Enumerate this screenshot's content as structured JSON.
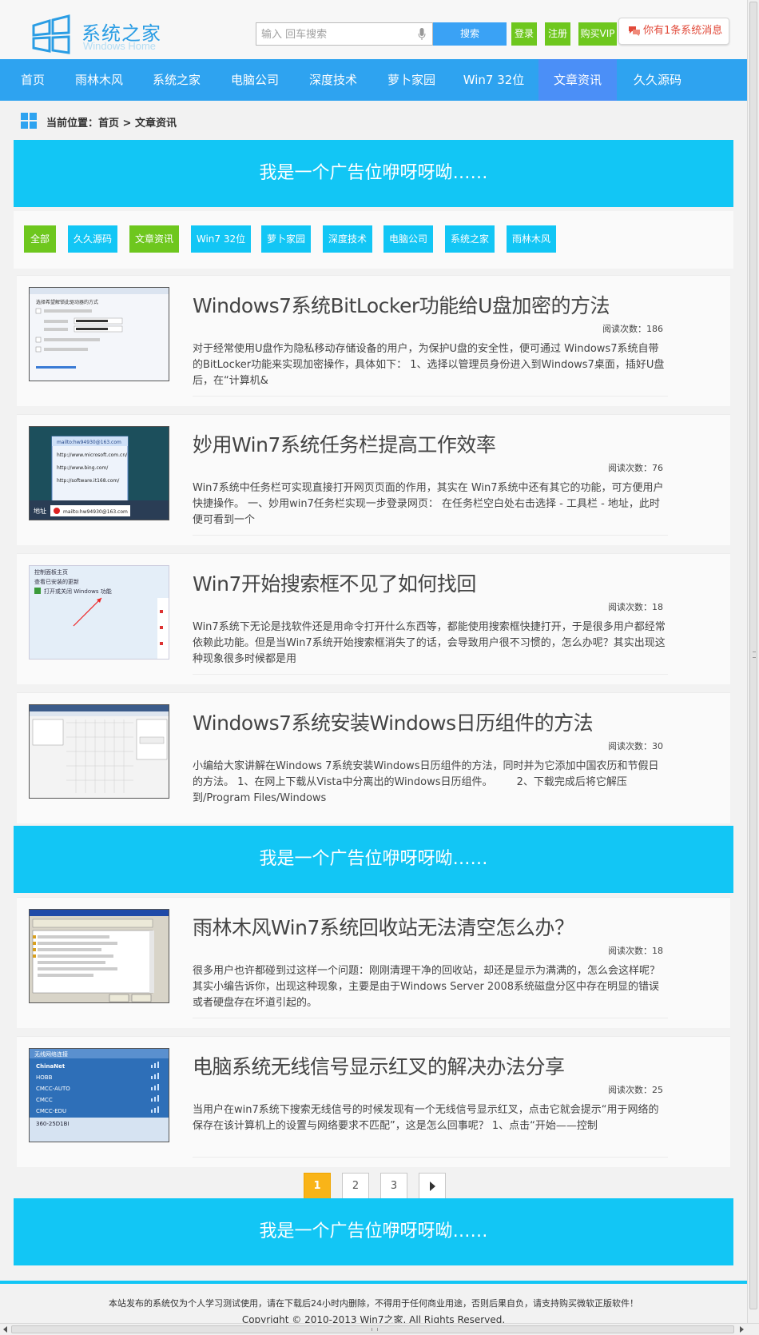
{
  "header": {
    "logo_text": "系统之家",
    "logo_sub": "Windows Home",
    "search_placeholder": "输入 回车搜索",
    "search_button": "搜索",
    "login": "登录",
    "register": "注册",
    "vip": "购买VIP",
    "message": "你有1条系统消息"
  },
  "nav": [
    "首页",
    "雨林木风",
    "系统之家",
    "电脑公司",
    "深度技术",
    "萝卜家园",
    "Win7 32位",
    "文章资讯",
    "久久源码"
  ],
  "breadcrumb": "当前位置：首页 > 文章资讯",
  "ads": [
    "我是一个广告位咿呀呀呦……",
    "我是一个广告位咿呀呀呦……",
    "我是一个广告位咿呀呀呦……"
  ],
  "filters": [
    "全部",
    "久久源码",
    "文章资讯",
    "Win7 32位",
    "萝卜家园",
    "深度技术",
    "电脑公司",
    "系统之家",
    "雨林木风"
  ],
  "articles": [
    {
      "title": "Windows7系统BitLocker功能给U盘加密的方法",
      "reads": "阅读次数：186",
      "desc": "对于经常使用U盘作为隐私移动存储设备的用户，为保护U盘的安全性，便可通过 Windows7系统自带的BitLocker功能来实现加密操作，具体如下： 1、选择以管理员身份进入到Windows7桌面，插好U盘后，在“计算机&"
    },
    {
      "title": "妙用Win7系统任务栏提高工作效率",
      "reads": "阅读次数：76",
      "desc": "Win7系统中任务栏可实现直接打开网页页面的作用，其实在 Win7系统中还有其它的功能，可方便用户快捷操作。 一、妙用win7任务栏实现一步登录网页： 在任务栏空白处右击选择 - 工具栏 - 地址，此时便可看到一个"
    },
    {
      "title": "Win7开始搜索框不见了如何找回",
      "reads": "阅读次数：18",
      "desc": "Win7系统下无论是找软件还是用命令打开什么东西等，都能使用搜索框快捷打开，于是很多用户都经常依赖此功能。但是当Win7系统开始搜索框消失了的话，会导致用户很不习惯的，怎么办呢？其实出现这种现象很多时候都是用"
    },
    {
      "title": "Windows7系统安装Windows日历组件的方法",
      "reads": "阅读次数：30",
      "desc": "小编给大家讲解在Windows 7系统安装Windows日历组件的方法，同时并为它添加中国农历和节假日的方法。 1、在网上下载从Vista中分离出的Windows日历组件。 　　2、下载完成后将它解压到/Program Files/Windows"
    },
    {
      "title": "雨林木风Win7系统回收站无法清空怎么办？",
      "reads": "阅读次数：18",
      "desc": "很多用户也许都碰到过这样一个问题：刚刚清理干净的回收站，却还是显示为满满的，怎么会这样呢？其实小编告诉你，出现这种现象，主要是由于Windows Server 2008系统磁盘分区中存在明显的错误或者硬盘存在坏道引起的。"
    },
    {
      "title": "电脑系统无线信号显示红叉的解决办法分享",
      "reads": "阅读次数：25",
      "desc": "当用户在win7系统下搜索无线信号的时候发现有一个无线信号显示红叉，点击它就会提示“用于网络的保存在该计算机上的设置与网络要求不匹配”，这是怎么回事呢？ 1、点击“开始——控制"
    }
  ],
  "thumb_text": {
    "t1_caption": "选择希望解锁此驱动器的方式",
    "t2_items": [
      "mailto:hw94930@163.com",
      "http://www.microsoft.com.cn/",
      "http://www.bing.com/",
      "http://software.it168.com/"
    ],
    "t2_label": "地址",
    "t3_lines": [
      "控制面板主页",
      "查看已安装的更新",
      "打开或关闭 Windows 功能"
    ],
    "t6_title": "无线网络连接",
    "t6_items": [
      "ChinaNet",
      "HOBB",
      "CMCC-AUTO",
      "CMCC",
      "CMCC-EDU",
      "360-25D1BI"
    ]
  },
  "pagination": [
    "1",
    "2",
    "3"
  ],
  "footer": {
    "line1": "本站发布的系统仅为个人学习测试使用，请在下载后24小时内删除，不得用于任何商业用途，否则后果自负，请支持购买微软正版软件！",
    "line2": "Copyright © 2010-2013 Win7之家. All Rights Reserved."
  }
}
